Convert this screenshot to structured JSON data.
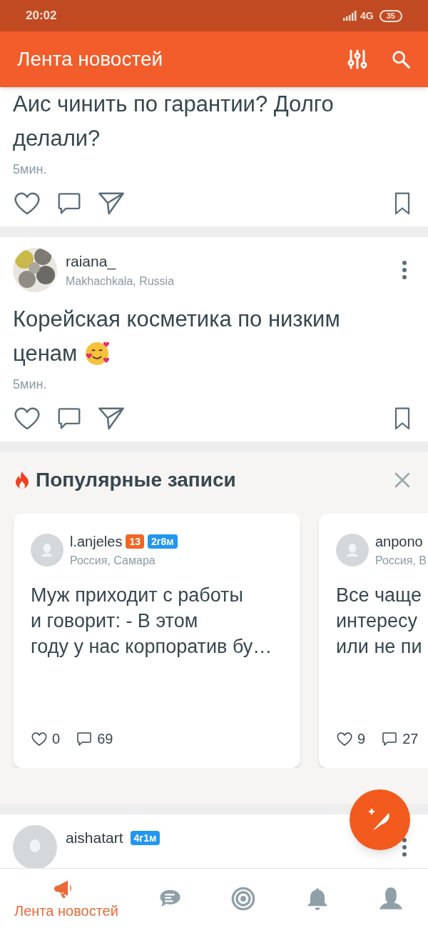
{
  "status_bar": {
    "time": "20:02",
    "network": "4G",
    "battery": "35"
  },
  "app_bar": {
    "title": "Лента новостей"
  },
  "posts": [
    {
      "lines": [
        "Аис чинить по гарантии? Долго",
        "делали?"
      ],
      "time": "5мин."
    },
    {
      "author": "raiana_",
      "location": "Makhachkala, Russia",
      "lines": [
        "Корейская косметика по низким",
        "ценам"
      ],
      "emoji": true,
      "time": "5мин."
    }
  ],
  "popular": {
    "title": "Популярные записи",
    "cards": [
      {
        "author": "l.anjeles",
        "badges": [
          {
            "text": "13",
            "color": "#f26522"
          },
          {
            "text": "2г8м",
            "color": "#2196f3"
          }
        ],
        "location": "Россия, Самара",
        "lines": [
          "Муж приходит с работы",
          "и говорит: - В этом",
          "году у нас корпоратив бу…"
        ],
        "likes": "0",
        "comments": "69"
      },
      {
        "author": "anpono",
        "location": "Россия, В",
        "lines": [
          "Все чаще",
          "интересу",
          "или не пи"
        ],
        "likes": "9",
        "comments": "27"
      }
    ]
  },
  "next_post": {
    "author": "aishatart",
    "badges": [
      {
        "text": "4г1м",
        "color": "#2196f3"
      }
    ]
  },
  "nav": [
    {
      "label": "Лента новостей",
      "selected": true
    },
    {
      "selected": false
    },
    {
      "selected": false
    },
    {
      "selected": false
    },
    {
      "selected": false
    }
  ]
}
